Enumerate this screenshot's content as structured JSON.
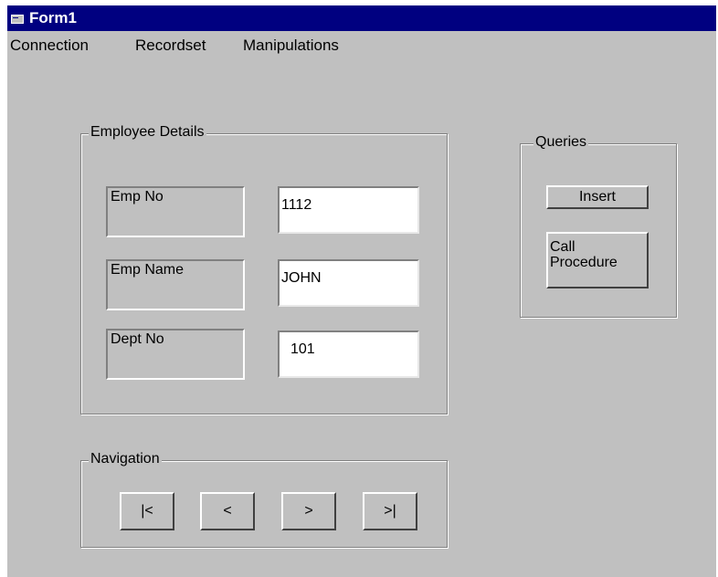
{
  "window": {
    "title": "Form1"
  },
  "menu": {
    "items": [
      "Connection",
      "Recordset",
      "Manipulations"
    ]
  },
  "employee_details": {
    "caption": "Employee Details",
    "fields": [
      {
        "label": "Emp No",
        "value": "1112"
      },
      {
        "label": "Emp Name",
        "value": "JOHN"
      },
      {
        "label": "Dept No",
        "value": "101"
      }
    ]
  },
  "queries": {
    "caption": "Queries",
    "insert_label": "Insert",
    "call_procedure_label_line1": "Call",
    "call_procedure_label_line2": "Procedure"
  },
  "navigation": {
    "caption": "Navigation",
    "first_label": "|<",
    "prev_label": "<",
    "next_label": ">",
    "last_label": ">|"
  }
}
